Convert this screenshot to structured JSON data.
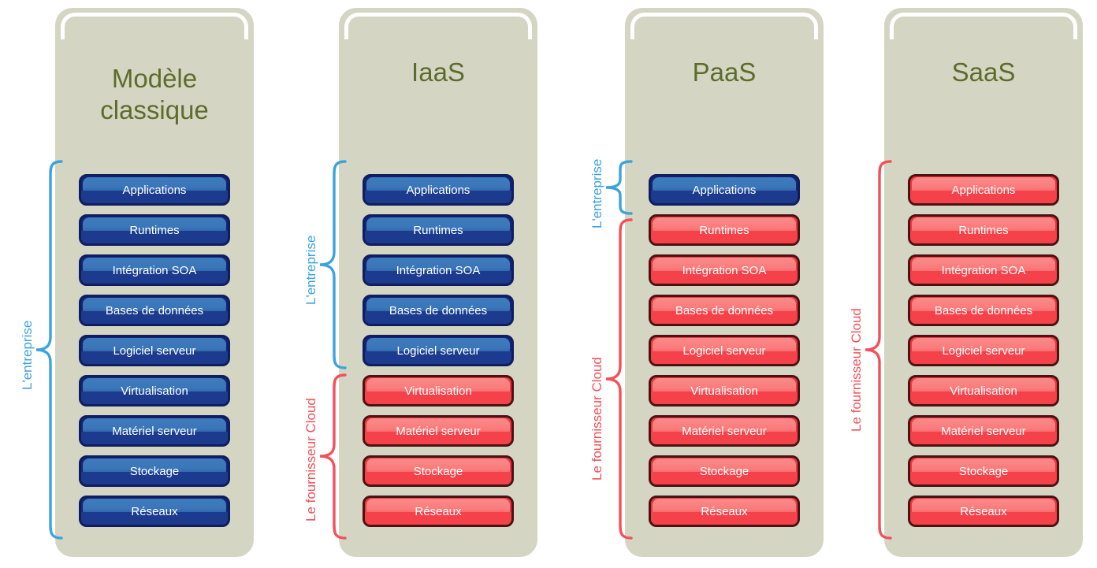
{
  "diagram": {
    "title_color": "#5d6b2b",
    "panel_color": "#d4d6c3",
    "enterprise_color": "#3ba3dd",
    "provider_color": "#f4505a",
    "blue_box_color": "#14257a",
    "red_box_color": "#f2353f"
  },
  "labels": {
    "enterprise": "L'entreprise",
    "provider": "Le fournisseur Cloud"
  },
  "layer_names": [
    "Applications",
    "Runtimes",
    "Intégration SOA",
    "Bases de données",
    "Logiciel serveur",
    "Virtualisation",
    "Matériel serveur",
    "Stockage",
    "Réseaux"
  ],
  "columns": [
    {
      "id": "modele-classique",
      "title_line1": "Modèle",
      "title_line2": "classique",
      "title": "Modèle classique",
      "enterprise_layers": 9,
      "provider_layers": 0,
      "layers": [
        {
          "name": "Applications",
          "owner": "enterprise"
        },
        {
          "name": "Runtimes",
          "owner": "enterprise"
        },
        {
          "name": "Intégration SOA",
          "owner": "enterprise"
        },
        {
          "name": "Bases de données",
          "owner": "enterprise"
        },
        {
          "name": "Logiciel serveur",
          "owner": "enterprise"
        },
        {
          "name": "Virtualisation",
          "owner": "enterprise"
        },
        {
          "name": "Matériel serveur",
          "owner": "enterprise"
        },
        {
          "name": "Stockage",
          "owner": "enterprise"
        },
        {
          "name": "Réseaux",
          "owner": "enterprise"
        }
      ]
    },
    {
      "id": "iaas",
      "title_line1": "IaaS",
      "title_line2": "",
      "title": "IaaS",
      "enterprise_layers": 5,
      "provider_layers": 4,
      "layers": [
        {
          "name": "Applications",
          "owner": "enterprise"
        },
        {
          "name": "Runtimes",
          "owner": "enterprise"
        },
        {
          "name": "Intégration SOA",
          "owner": "enterprise"
        },
        {
          "name": "Bases de données",
          "owner": "enterprise"
        },
        {
          "name": "Logiciel serveur",
          "owner": "enterprise"
        },
        {
          "name": "Virtualisation",
          "owner": "provider"
        },
        {
          "name": "Matériel serveur",
          "owner": "provider"
        },
        {
          "name": "Stockage",
          "owner": "provider"
        },
        {
          "name": "Réseaux",
          "owner": "provider"
        }
      ]
    },
    {
      "id": "paas",
      "title_line1": "PaaS",
      "title_line2": "",
      "title": "PaaS",
      "enterprise_layers": 1,
      "provider_layers": 8,
      "layers": [
        {
          "name": "Applications",
          "owner": "enterprise"
        },
        {
          "name": "Runtimes",
          "owner": "provider"
        },
        {
          "name": "Intégration SOA",
          "owner": "provider"
        },
        {
          "name": "Bases de données",
          "owner": "provider"
        },
        {
          "name": "Logiciel serveur",
          "owner": "provider"
        },
        {
          "name": "Virtualisation",
          "owner": "provider"
        },
        {
          "name": "Matériel serveur",
          "owner": "provider"
        },
        {
          "name": "Stockage",
          "owner": "provider"
        },
        {
          "name": "Réseaux",
          "owner": "provider"
        }
      ]
    },
    {
      "id": "saas",
      "title_line1": "SaaS",
      "title_line2": "",
      "title": "SaaS",
      "enterprise_layers": 0,
      "provider_layers": 9,
      "layers": [
        {
          "name": "Applications",
          "owner": "provider"
        },
        {
          "name": "Runtimes",
          "owner": "provider"
        },
        {
          "name": "Intégration SOA",
          "owner": "provider"
        },
        {
          "name": "Bases de données",
          "owner": "provider"
        },
        {
          "name": "Logiciel serveur",
          "owner": "provider"
        },
        {
          "name": "Virtualisation",
          "owner": "provider"
        },
        {
          "name": "Matériel serveur",
          "owner": "provider"
        },
        {
          "name": "Stockage",
          "owner": "provider"
        },
        {
          "name": "Réseaux",
          "owner": "provider"
        }
      ]
    }
  ]
}
